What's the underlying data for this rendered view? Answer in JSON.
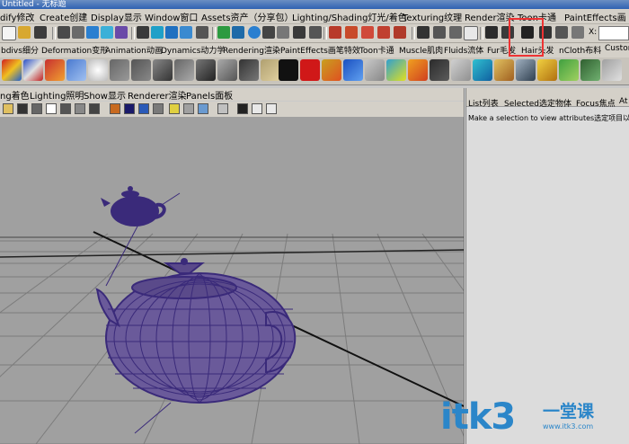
{
  "window": {
    "title": "Untitled - 无标题"
  },
  "menubar": {
    "items": [
      "dify修改",
      "Create创建",
      "Display显示",
      "Window窗口",
      "Assets资产（分享包）",
      "Lighting/Shading灯光/着色",
      "Texturing纹理",
      "Render渲染",
      "Toon卡通",
      "PaintEffects画"
    ]
  },
  "toolbar": {
    "x_label": "X:"
  },
  "shelf_tabs": {
    "items": [
      "bdivs细分",
      "Deformation变形",
      "Animation动画",
      "Dynamics动力学",
      "Rendering渲染",
      "PaintEffects画笔特效",
      "Toon卡通",
      "Muscle肌肉",
      "Fluids流体",
      "Fur毛发",
      "Hair头发",
      "nCloth布料",
      "Custom"
    ]
  },
  "panel_menu": {
    "items": [
      "ng着色",
      "Lighting照明",
      "Show显示",
      "Renderer渲染",
      "Panels面板"
    ]
  },
  "attribute_editor": {
    "tabs": [
      "List列表",
      "Selected选定物体",
      "Focus焦点",
      "At"
    ],
    "message": "Make a selection to view attributes选定项目以查"
  },
  "watermark": {
    "logo": "itk3",
    "cn": "一堂课",
    "url": "www.itk3.com"
  },
  "colors": {
    "wireframe": "#3a2a7a",
    "viewport_bg": "#a0a0a0",
    "grid": "#7c7c7c",
    "accent_red": "#e33333",
    "watermark": "#2b86c9"
  }
}
